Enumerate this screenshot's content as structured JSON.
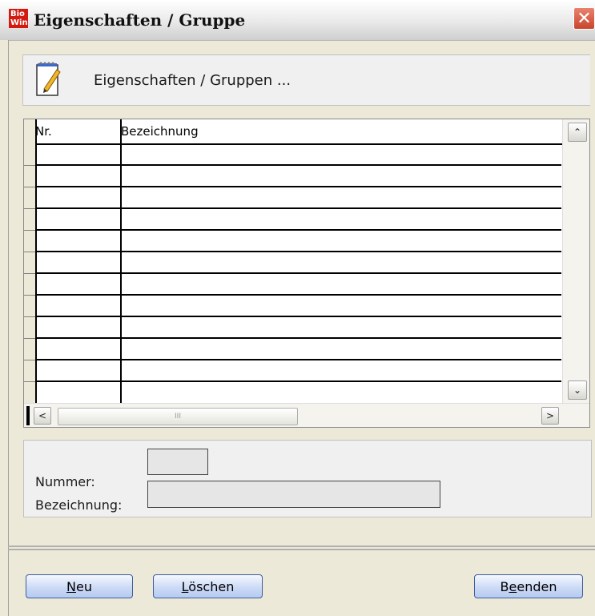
{
  "window": {
    "title": "Eigenschaften / Gruppe",
    "app_icon_text": [
      "Bio",
      "Win"
    ],
    "close_glyph": "✕"
  },
  "header": {
    "icon": "notepad-icon",
    "text": "Eigenschaften / Gruppen ..."
  },
  "table": {
    "columns": [
      "Nr.",
      "Bezeichnung"
    ],
    "rows": [],
    "scroll_up_glyph": "⌃",
    "scroll_down_glyph": "⌄",
    "scroll_left_glyph": "<",
    "scroll_right_glyph": ">",
    "thumb_grip": "III"
  },
  "fields": {
    "nummer_label": "Nummer:",
    "nummer_value": "",
    "bezeichnung_label": "Bezeichnung:",
    "bezeichnung_value": ""
  },
  "buttons": {
    "neu_first": "N",
    "neu_rest": "eu",
    "loeschen_first": "L",
    "loeschen_rest": "öschen",
    "beenden_first": "B",
    "beenden_mid": "e",
    "beenden_rest": "enden"
  },
  "colors": {
    "background": "#ECE9D8",
    "button_border": "#3b5c9c",
    "close_button": "#c9452c"
  }
}
